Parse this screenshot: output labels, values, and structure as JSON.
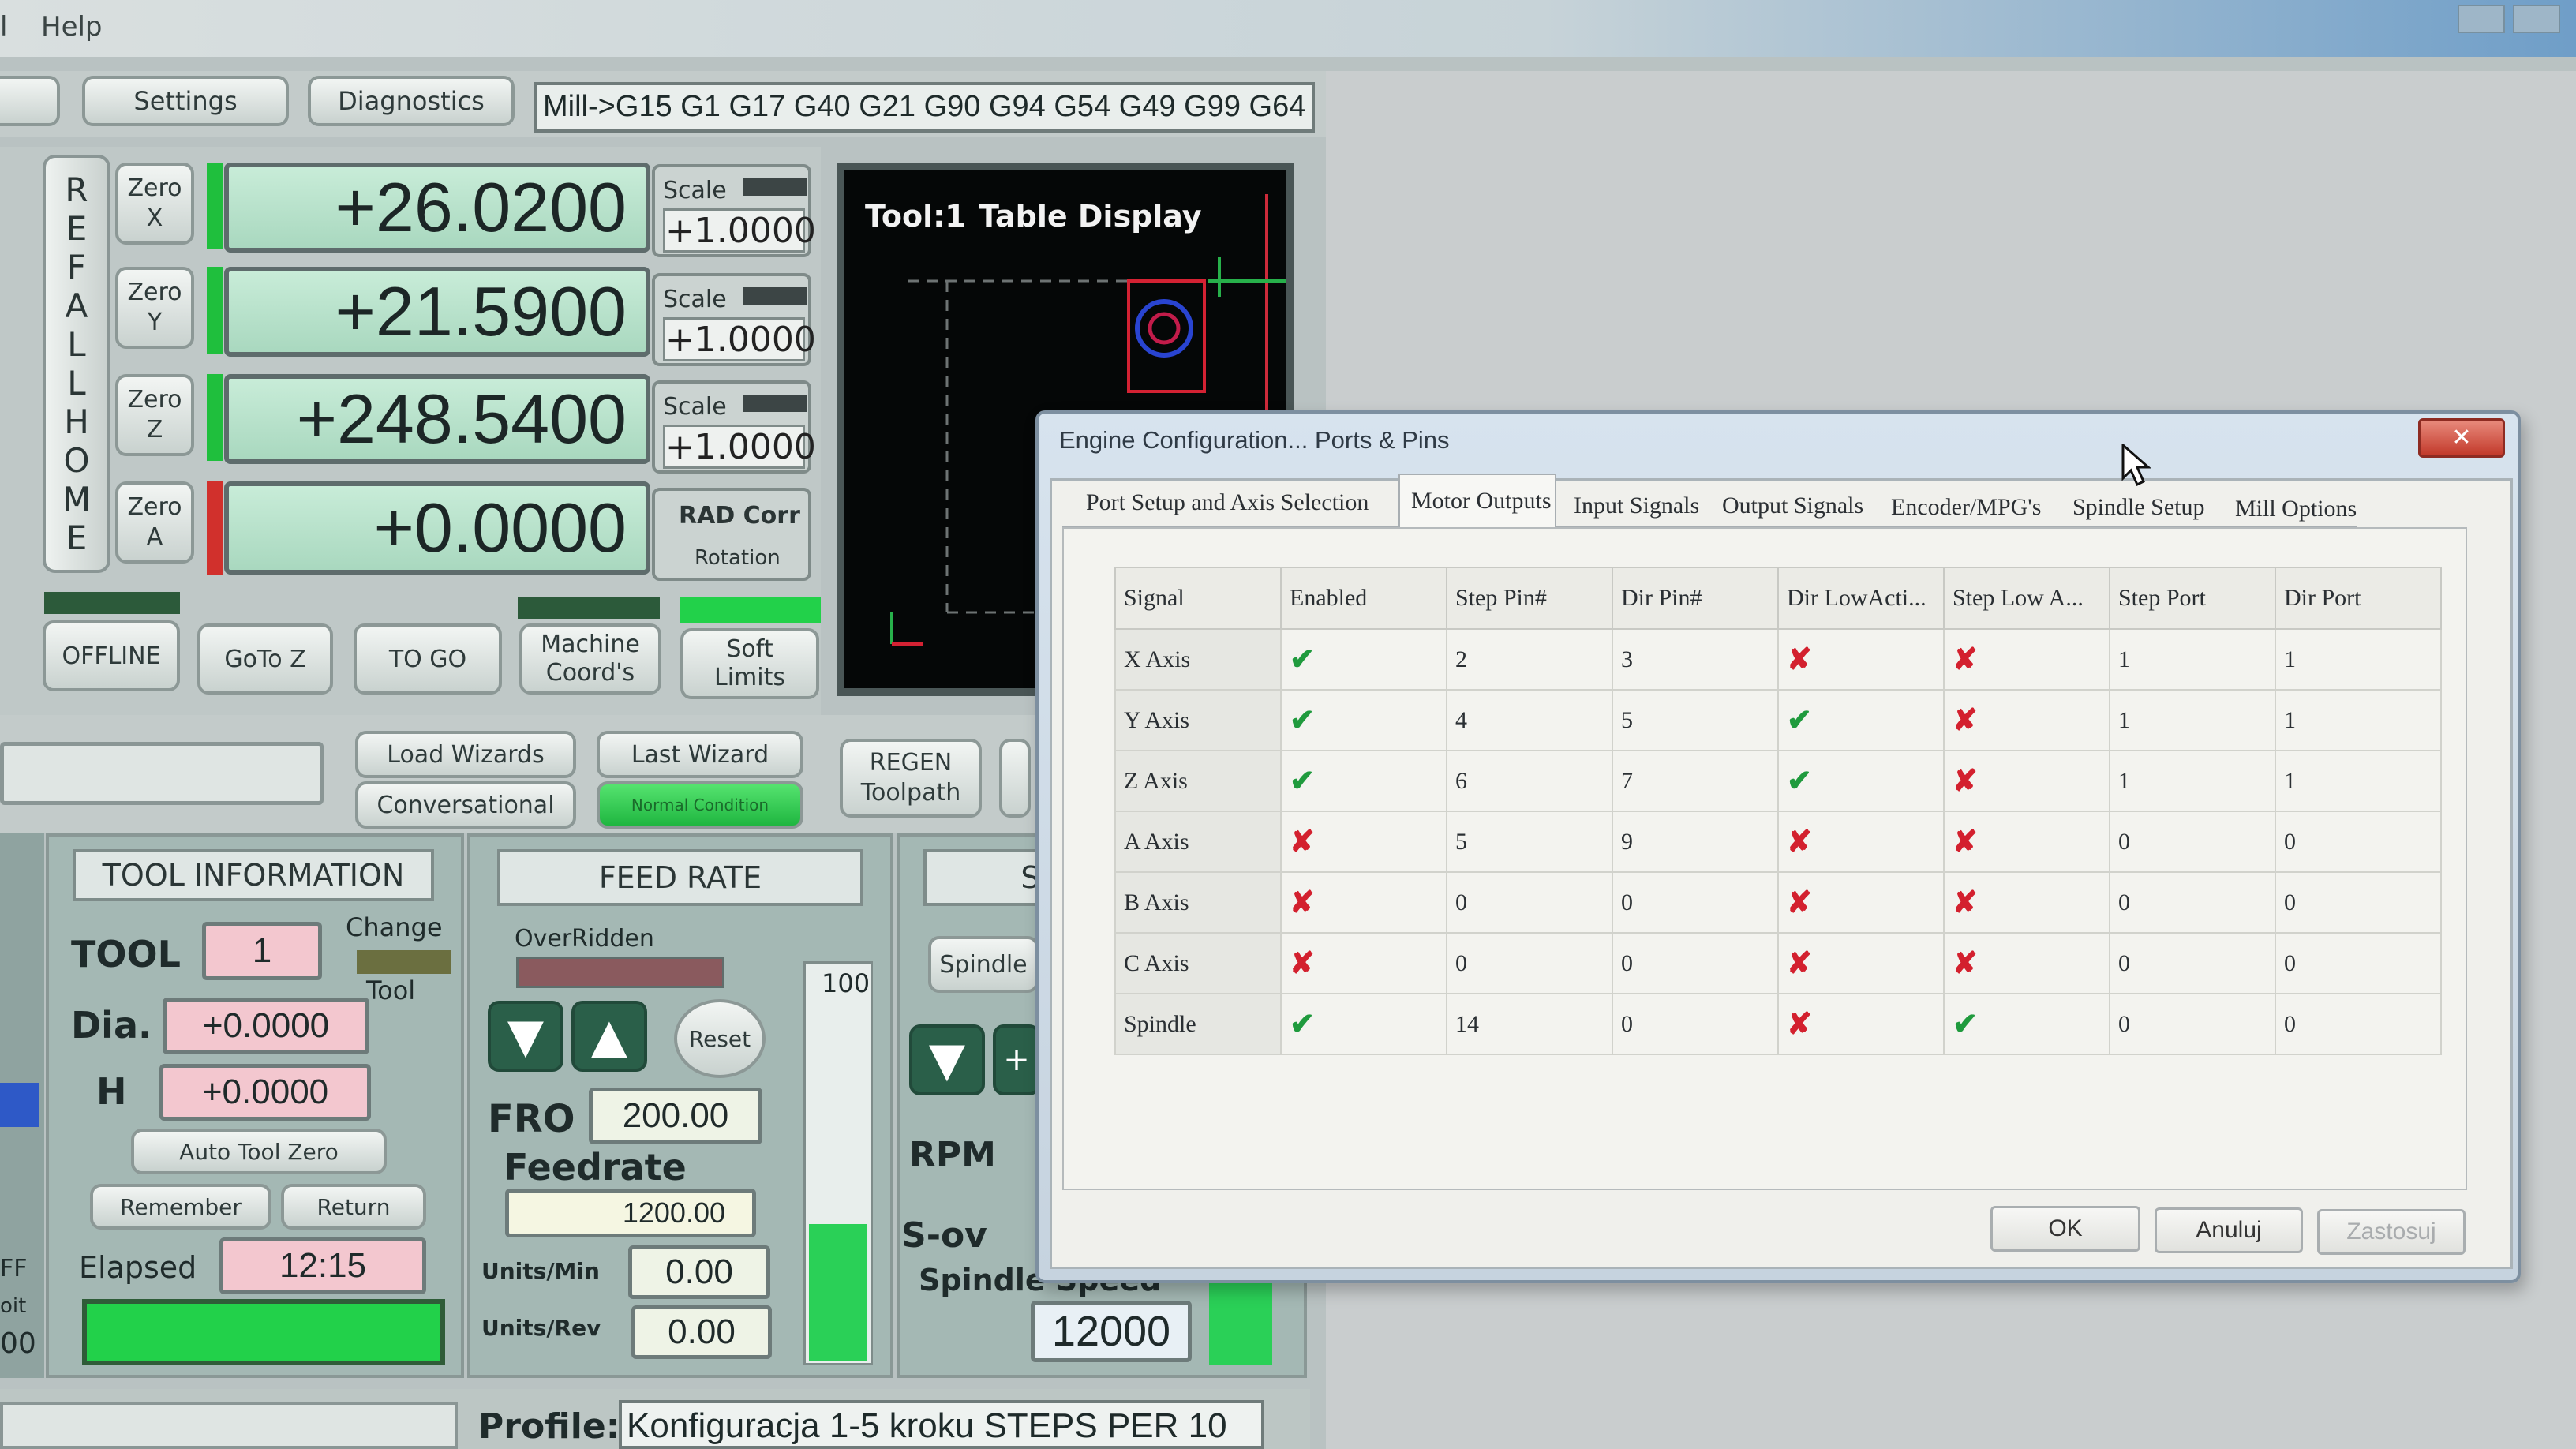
{
  "menu": {
    "items": [
      "l",
      "Help"
    ]
  },
  "toolbar": {
    "settings": "Settings",
    "diagnostics": "Diagnostics",
    "gcodes": "Mill->G15  G1 G17 G40 G21 G90 G94 G54 G49 G99 G64"
  },
  "ref_all_home": [
    "R",
    "E",
    "F",
    "A",
    "L",
    "L",
    "H",
    "O",
    "M",
    "E"
  ],
  "axes": [
    {
      "zero_label": "Zero X",
      "value": "+26.0200",
      "scale_label": "Scale",
      "scale_value": "+1.0000"
    },
    {
      "zero_label": "Zero Y",
      "value": "+21.5900",
      "scale_label": "Scale",
      "scale_value": "+1.0000"
    },
    {
      "zero_label": "Zero Z",
      "value": "+248.5400",
      "scale_label": "Scale",
      "scale_value": "+1.0000"
    },
    {
      "zero_label": "Zero A",
      "value": "+0.0000",
      "scale_label": "RAD Corr",
      "scale_value": "Rotation"
    }
  ],
  "buttons_row": {
    "offline": "OFFLINE",
    "gotoz": "GoTo Z",
    "togo": "TO GO",
    "machine_coords": "Machine Coord's",
    "soft_limits": "Soft Limits"
  },
  "toolpath": {
    "tool": "Tool:1",
    "title": "Table Display"
  },
  "wizards": {
    "load": "Load Wizards",
    "last": "Last Wizard",
    "conversational": "Conversational",
    "normal": "Normal Condition",
    "regen": "REGEN Toolpath"
  },
  "tool_info": {
    "title": "TOOL INFORMATION",
    "tool_label": "TOOL",
    "tool_value": "1",
    "change": "Change",
    "change_tool": "Tool",
    "dia_label": "Dia.",
    "dia_value": "+0.0000",
    "h_label": "H",
    "h_value": "+0.0000",
    "auto_zero": "Auto Tool Zero",
    "remember": "Remember",
    "return": "Return",
    "elapsed_label": "Elapsed",
    "elapsed_value": "12:15"
  },
  "feed_rate": {
    "title": "FEED RATE",
    "overridden": "OverRidden",
    "reset": "Reset",
    "fro_label": "FRO",
    "fro_value": "200.00",
    "feedrate_label": "Feedrate",
    "feedrate_value": "1200.00",
    "slider_max": "100",
    "units_min_label": "Units/Min",
    "units_min_value": "0.00",
    "units_rev_label": "Units/Rev",
    "units_rev_value": "0.00"
  },
  "spindle": {
    "title": "SPIN",
    "spindle_btn": "Spindle",
    "rpm_label": "RPM",
    "sov_label": "S-ov",
    "speed_label": "Spindle Speed",
    "speed_value": "12000"
  },
  "left_edge": {
    "ff": "FF",
    "oit": "oit",
    "val": "00"
  },
  "profile": {
    "label": "Profile:",
    "value": "Konfiguracja 1-5 kroku STEPS PER 10"
  },
  "dialog": {
    "title": "Engine Configuration... Ports & Pins",
    "close": "✕",
    "tabs": [
      "Port Setup and Axis Selection",
      "Motor Outputs",
      "Input Signals",
      "Output Signals",
      "Encoder/MPG's",
      "Spindle Setup",
      "Mill Options"
    ],
    "active_tab": "Motor Outputs",
    "columns": [
      "Signal",
      "Enabled",
      "Step Pin#",
      "Dir Pin#",
      "Dir LowActi...",
      "Step Low A...",
      "Step Port",
      "Dir Port"
    ],
    "rows": [
      {
        "signal": "X Axis",
        "enabled": true,
        "step_pin": "2",
        "dir_pin": "3",
        "dir_low": false,
        "step_low": false,
        "step_port": "1",
        "dir_port": "1"
      },
      {
        "signal": "Y Axis",
        "enabled": true,
        "step_pin": "4",
        "dir_pin": "5",
        "dir_low": true,
        "step_low": false,
        "step_port": "1",
        "dir_port": "1"
      },
      {
        "signal": "Z Axis",
        "enabled": true,
        "step_pin": "6",
        "dir_pin": "7",
        "dir_low": true,
        "step_low": false,
        "step_port": "1",
        "dir_port": "1"
      },
      {
        "signal": "A Axis",
        "enabled": false,
        "step_pin": "5",
        "dir_pin": "9",
        "dir_low": false,
        "step_low": false,
        "step_port": "0",
        "dir_port": "0"
      },
      {
        "signal": "B Axis",
        "enabled": false,
        "step_pin": "0",
        "dir_pin": "0",
        "dir_low": false,
        "step_low": false,
        "step_port": "0",
        "dir_port": "0"
      },
      {
        "signal": "C Axis",
        "enabled": false,
        "step_pin": "0",
        "dir_pin": "0",
        "dir_low": false,
        "step_low": false,
        "step_port": "0",
        "dir_port": "0"
      },
      {
        "signal": "Spindle",
        "enabled": true,
        "step_pin": "14",
        "dir_pin": "0",
        "dir_low": false,
        "step_low": true,
        "step_port": "0",
        "dir_port": "0"
      }
    ],
    "ok": "OK",
    "cancel": "Anuluj",
    "apply": "Zastosuj"
  },
  "colors": {
    "accent_green": "#22d14a",
    "check_green": "#1f9a3d",
    "cross_red": "#d3202e",
    "dro_bg": "#b9e3cc"
  }
}
